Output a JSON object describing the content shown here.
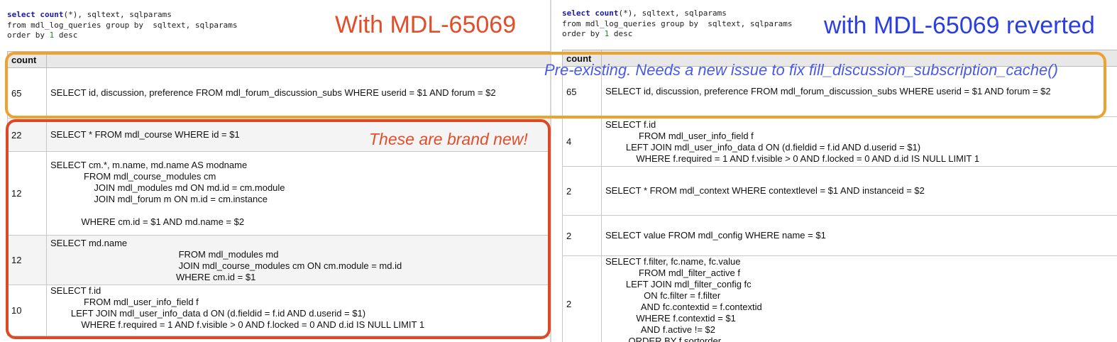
{
  "left": {
    "sql": {
      "line1_kw1": "select",
      "line1_kw2": "count",
      "line1_rest": "(*), sqltext, sqlparams",
      "line2": "from mdl_log_queries group by  sqltext, sqlparams",
      "line3_pre": "order by ",
      "line3_num": "1",
      "line3_post": " desc"
    },
    "title": "With MDL-65069",
    "note": "These are brand new!",
    "header": "count",
    "rows": [
      {
        "count": "65",
        "query": "SELECT id, discussion, preference FROM mdl_forum_discussion_subs WHERE userid = $1 AND forum = $2"
      },
      {
        "count": "22",
        "query": "SELECT * FROM mdl_course WHERE id = $1"
      },
      {
        "count": "12",
        "query": "SELECT cm.*, m.name, md.name AS modname\n             FROM mdl_course_modules cm\n                 JOIN mdl_modules md ON md.id = cm.module\n                 JOIN mdl_forum m ON m.id = cm.instance\n\n            WHERE cm.id = $1 AND md.name = $2"
      },
      {
        "count": "12",
        "query": "SELECT md.name\n                                                  FROM mdl_modules md\n                                                  JOIN mdl_course_modules cm ON cm.module = md.id\n                                                 WHERE cm.id = $1"
      },
      {
        "count": "10",
        "query": "SELECT f.id\n             FROM mdl_user_info_field f\n        LEFT JOIN mdl_user_info_data d ON (d.fieldid = f.id AND d.userid = $1)\n            WHERE f.required = 1 AND f.visible > 0 AND f.locked = 0 AND d.id IS NULL LIMIT 1"
      }
    ]
  },
  "right": {
    "sql": {
      "line1_kw1": "select",
      "line1_kw2": "count",
      "line1_rest": "(*), sqltext, sqlparams",
      "line2": "from mdl_log_queries group by  sqltext, sqlparams",
      "line3_pre": "order by ",
      "line3_num": "1",
      "line3_post": " desc"
    },
    "title": "with MDL-65069 reverted",
    "note": "Pre-existing. Needs a new issue to fix fill_discussion_subscription_cache()",
    "header": "count",
    "rows": [
      {
        "count": "65",
        "query": "SELECT id, discussion, preference FROM mdl_forum_discussion_subs WHERE userid = $1 AND forum = $2"
      },
      {
        "count": "4",
        "query": "SELECT f.id\n             FROM mdl_user_info_field f\n        LEFT JOIN mdl_user_info_data d ON (d.fieldid = f.id AND d.userid = $1)\n            WHERE f.required = 1 AND f.visible > 0 AND f.locked = 0 AND d.id IS NULL LIMIT 1"
      },
      {
        "count": "2",
        "query": "SELECT * FROM mdl_context WHERE contextlevel = $1 AND instanceid = $2"
      },
      {
        "count": "2",
        "query": "SELECT value FROM mdl_config WHERE name = $1"
      },
      {
        "count": "2",
        "query": "SELECT f.filter, fc.name, fc.value\n             FROM mdl_filter_active f\n        LEFT JOIN mdl_filter_config fc\n               ON fc.filter = f.filter\n              AND fc.contextid = f.contextid\n            WHERE f.contextid = $1\n              AND f.active != $2\n         ORDER BY f.sortorder"
      }
    ]
  },
  "colors": {
    "left_title": "#e04e2b",
    "right_title": "#2b3fe0",
    "orange_box": "#efa12d",
    "red_box": "#db4a26",
    "note_blue": "#4a5ae8"
  }
}
